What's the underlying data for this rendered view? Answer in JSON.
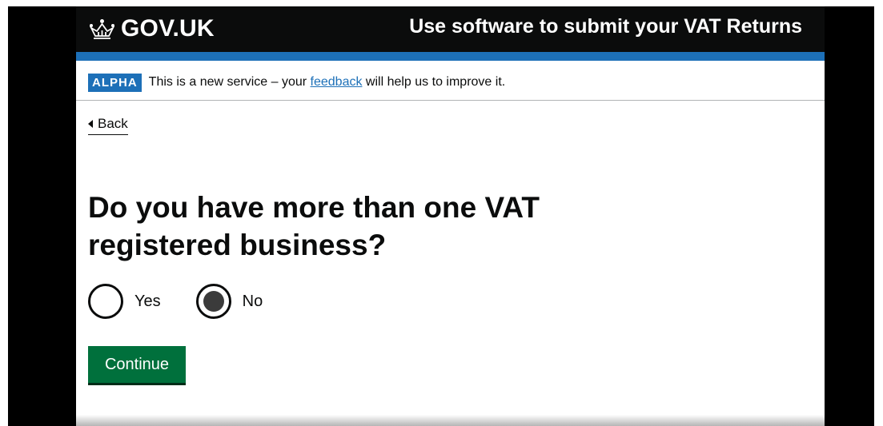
{
  "header": {
    "logo_text": "GOV.UK",
    "logo_icon": "crown-icon",
    "service_name": "Use software to submit your VAT Returns"
  },
  "phase_banner": {
    "tag": "ALPHA",
    "text_before": "This is a new service – your ",
    "link_text": "feedback",
    "text_after": " will help us to improve it."
  },
  "back_link": {
    "label": "Back",
    "icon": "triangle-left-icon"
  },
  "question": {
    "title": "Do you have more than one VAT registered business?"
  },
  "radios": {
    "options": [
      {
        "label": "Yes",
        "selected": false
      },
      {
        "label": "No",
        "selected": true
      }
    ]
  },
  "actions": {
    "continue_label": "Continue"
  },
  "colors": {
    "header_bg": "#0b0c0c",
    "brand_blue": "#1d70b8",
    "button_green": "#00703c",
    "text": "#0b0c0c"
  }
}
